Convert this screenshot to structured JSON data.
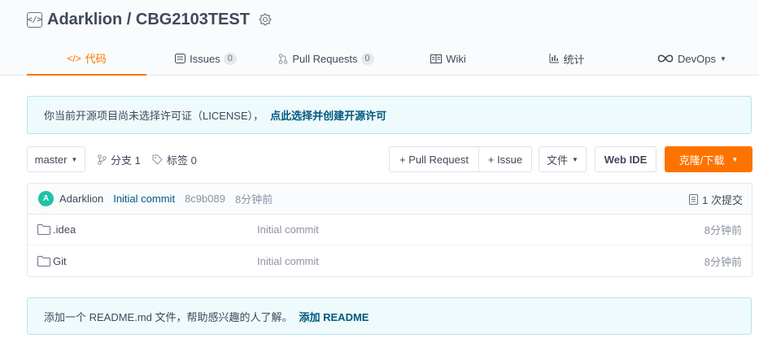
{
  "repo": {
    "title": "Adarklion / CBG2103TEST"
  },
  "tabs": [
    {
      "label": "代码",
      "icon": "code-icon"
    },
    {
      "label": "Issues",
      "count": "0",
      "icon": "issues-icon"
    },
    {
      "label": "Pull Requests",
      "count": "0",
      "icon": "pull-request-icon"
    },
    {
      "label": "Wiki",
      "icon": "wiki-icon"
    },
    {
      "label": "统计",
      "icon": "stats-icon"
    },
    {
      "label": "DevOps",
      "icon": "infinity-icon"
    }
  ],
  "license_notice": {
    "text": "你当前开源项目尚未选择许可证（LICENSE），",
    "link": "点此选择并创建开源许可"
  },
  "toolbar": {
    "branch": "master",
    "branches_label": "分支 1",
    "tags_label": "标签 0",
    "pull_request_button": "+ Pull Request",
    "issue_button": "+ Issue",
    "file_button": "文件",
    "web_ide_button": "Web IDE",
    "clone_button": "克隆/下载"
  },
  "last_commit": {
    "avatar_letter": "A",
    "author": "Adarklion",
    "message": "Initial commit",
    "sha": "8c9b089",
    "time": "8分钟前",
    "commit_count": "1 次提交"
  },
  "files": [
    {
      "name": ".idea",
      "commit": "Initial commit",
      "time": "8分钟前"
    },
    {
      "name": "Git",
      "commit": "Initial commit",
      "time": "8分钟前"
    }
  ],
  "readme_notice": {
    "text": "添加一个 README.md 文件，帮助感兴趣的人了解。",
    "link": "添加 README"
  },
  "colors": {
    "accent": "#fe7300",
    "link": "#005980",
    "notice_bg": "#effafc",
    "avatar": "#1fc2a6"
  }
}
